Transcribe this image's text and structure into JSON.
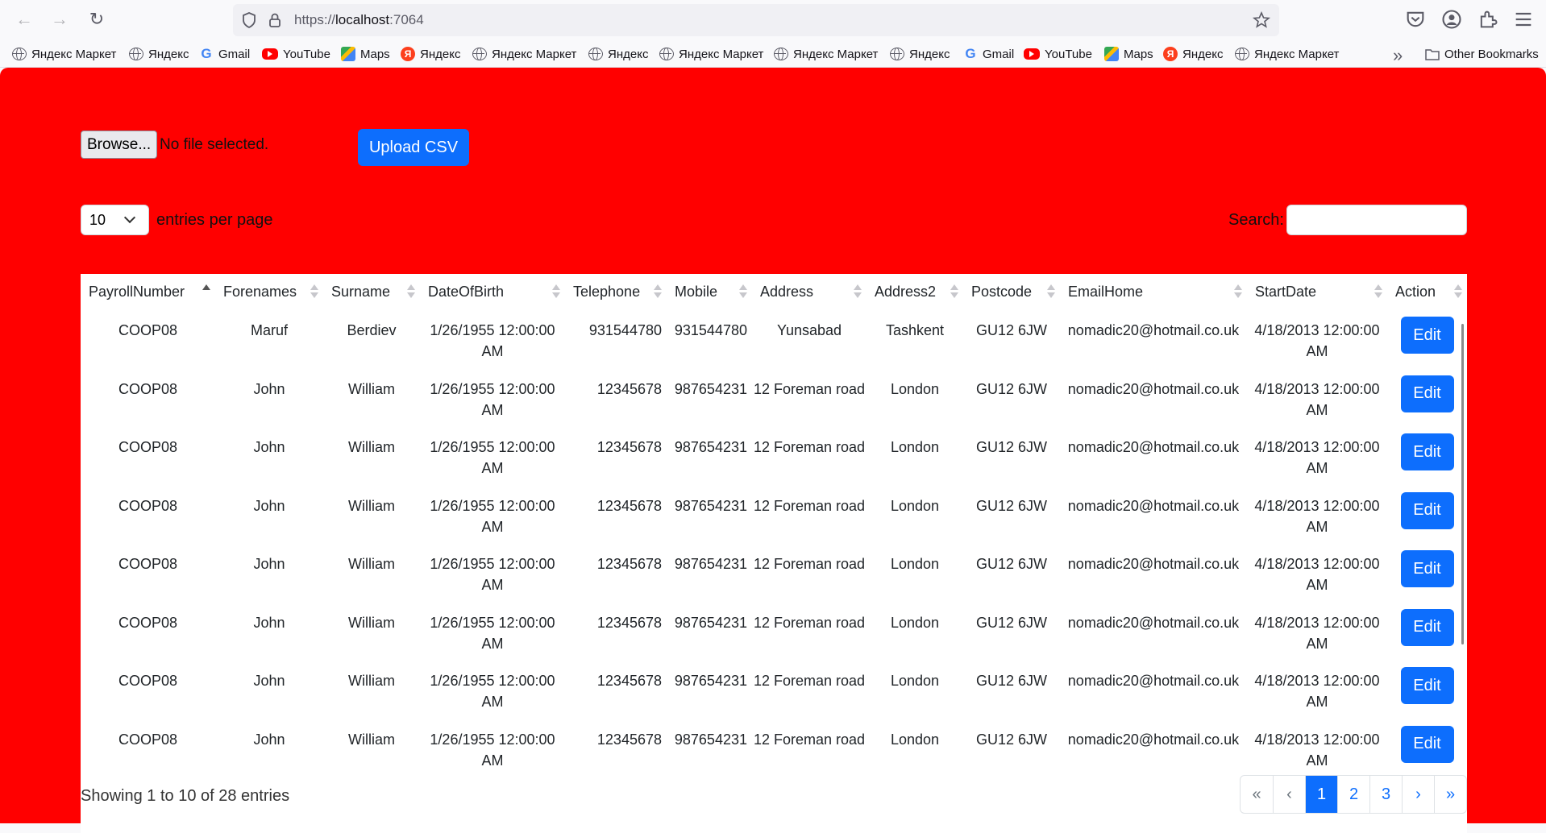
{
  "browser": {
    "url_prefix": "https://",
    "url_host": "localhost",
    "url_suffix": ":7064",
    "bookmarks": [
      {
        "icon": "globe",
        "label": "Яндекс Маркет"
      },
      {
        "icon": "globe",
        "label": "Яндекс"
      },
      {
        "icon": "gmail",
        "label": "Gmail"
      },
      {
        "icon": "youtube",
        "label": "YouTube"
      },
      {
        "icon": "maps",
        "label": "Maps"
      },
      {
        "icon": "yandex",
        "label": "Яндекс"
      },
      {
        "icon": "globe",
        "label": "Яндекс Маркет"
      },
      {
        "icon": "globe",
        "label": "Яндекс"
      },
      {
        "icon": "globe",
        "label": "Яндекс Маркет"
      },
      {
        "icon": "globe",
        "label": "Яндекс Маркет"
      },
      {
        "icon": "globe",
        "label": "Яндекс"
      },
      {
        "icon": "gmail",
        "label": "Gmail"
      },
      {
        "icon": "youtube",
        "label": "YouTube"
      },
      {
        "icon": "maps",
        "label": "Maps"
      },
      {
        "icon": "yandex",
        "label": "Яндекс"
      },
      {
        "icon": "globe",
        "label": "Яндекс Маркет"
      }
    ],
    "other_bookmarks": "Other Bookmarks"
  },
  "upload": {
    "browse_label": "Browse...",
    "file_status": "No file selected.",
    "upload_label": "Upload CSV"
  },
  "controls": {
    "per_page_value": "10",
    "per_page_label": "entries per page",
    "search_label": "Search:",
    "search_value": ""
  },
  "table": {
    "columns": [
      "PayrollNumber",
      "Forenames",
      "Surname",
      "DateOfBirth",
      "Telephone",
      "Mobile",
      "Address",
      "Address2",
      "Postcode",
      "EmailHome",
      "StartDate",
      "Action"
    ],
    "sorted_column": "PayrollNumber",
    "action_label": "Edit",
    "rows": [
      [
        "COOP08",
        "Maruf",
        "Berdiev",
        "1/26/1955 12:00:00 AM",
        "931544780",
        "931544780",
        "Yunsabad",
        "Tashkent",
        "GU12 6JW",
        "nomadic20@hotmail.co.uk",
        "4/18/2013 12:00:00 AM"
      ],
      [
        "COOP08",
        "John",
        "William",
        "1/26/1955 12:00:00 AM",
        "12345678",
        "987654231",
        "12 Foreman road",
        "London",
        "GU12 6JW",
        "nomadic20@hotmail.co.uk",
        "4/18/2013 12:00:00 AM"
      ],
      [
        "COOP08",
        "John",
        "William",
        "1/26/1955 12:00:00 AM",
        "12345678",
        "987654231",
        "12 Foreman road",
        "London",
        "GU12 6JW",
        "nomadic20@hotmail.co.uk",
        "4/18/2013 12:00:00 AM"
      ],
      [
        "COOP08",
        "John",
        "William",
        "1/26/1955 12:00:00 AM",
        "12345678",
        "987654231",
        "12 Foreman road",
        "London",
        "GU12 6JW",
        "nomadic20@hotmail.co.uk",
        "4/18/2013 12:00:00 AM"
      ],
      [
        "COOP08",
        "John",
        "William",
        "1/26/1955 12:00:00 AM",
        "12345678",
        "987654231",
        "12 Foreman road",
        "London",
        "GU12 6JW",
        "nomadic20@hotmail.co.uk",
        "4/18/2013 12:00:00 AM"
      ],
      [
        "COOP08",
        "John",
        "William",
        "1/26/1955 12:00:00 AM",
        "12345678",
        "987654231",
        "12 Foreman road",
        "London",
        "GU12 6JW",
        "nomadic20@hotmail.co.uk",
        "4/18/2013 12:00:00 AM"
      ],
      [
        "COOP08",
        "John",
        "William",
        "1/26/1955 12:00:00 AM",
        "12345678",
        "987654231",
        "12 Foreman road",
        "London",
        "GU12 6JW",
        "nomadic20@hotmail.co.uk",
        "4/18/2013 12:00:00 AM"
      ],
      [
        "COOP08",
        "John",
        "William",
        "1/26/1955 12:00:00 AM",
        "12345678",
        "987654231",
        "12 Foreman road",
        "London",
        "GU12 6JW",
        "nomadic20@hotmail.co.uk",
        "4/18/2013 12:00:00 AM"
      ]
    ]
  },
  "footer": {
    "info": "Showing 1 to 10 of 28 entries",
    "pages": [
      {
        "label": "«",
        "state": "disabled",
        "name": "first"
      },
      {
        "label": "‹",
        "state": "disabled",
        "name": "prev"
      },
      {
        "label": "1",
        "state": "active",
        "name": "1"
      },
      {
        "label": "2",
        "state": "",
        "name": "2"
      },
      {
        "label": "3",
        "state": "",
        "name": "3"
      },
      {
        "label": "›",
        "state": "",
        "name": "next"
      },
      {
        "label": "»",
        "state": "",
        "name": "last"
      }
    ]
  },
  "colors": {
    "page_background": "#ff0000",
    "primary": "#0d6efd"
  }
}
